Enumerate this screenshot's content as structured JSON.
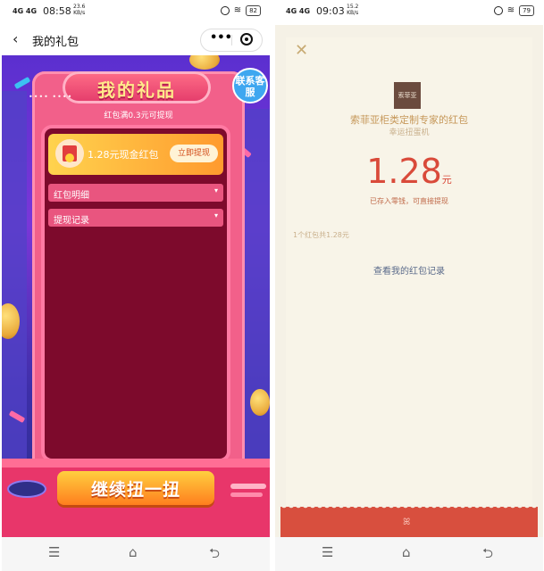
{
  "left": {
    "status": {
      "signal": "4G 4G",
      "time": "08:58",
      "speed_value": "23.6",
      "speed_unit": "KB/s",
      "wifi": "≋",
      "battery": "82"
    },
    "nav": {
      "back": "‹",
      "title": "我的礼包",
      "more": "•••"
    },
    "game": {
      "title": "我的礼品",
      "customer_service": "联系客服",
      "subtitle": "红包满0.3元可提现",
      "cash_card_label": "1.28元现金红包",
      "withdraw_button": "立即提现",
      "dropdowns": [
        {
          "label": "红包明细"
        },
        {
          "label": "提现记录"
        }
      ],
      "caret": "▾",
      "spin_button": "继续扭一扭",
      "deco_dots": "•••• ••••"
    }
  },
  "right": {
    "status": {
      "signal": "4G 4G",
      "time": "09:03",
      "speed_value": "15.2",
      "speed_unit": "KB/s",
      "wifi": "≋",
      "battery": "79"
    },
    "packet": {
      "close": "✕",
      "logo_text": "索菲亚",
      "title": "索菲亚柜类定制专家的红包",
      "subtitle": "幸运扭蛋机",
      "amount": "1.28",
      "unit": "元",
      "note": "已存入零钱，可直接提现",
      "count": "1个红包共1.28元",
      "link": "查看我的红包记录",
      "bottom_icon": "ꕤ"
    }
  },
  "sysnav": {
    "menu": "☰",
    "home": "⌂",
    "back": "⮌"
  },
  "colors": {
    "accent_red": "#d94a3a",
    "game_purple": "#5b2fcf",
    "frame_pink": "#f2608a",
    "gold": "#ffd34e"
  }
}
